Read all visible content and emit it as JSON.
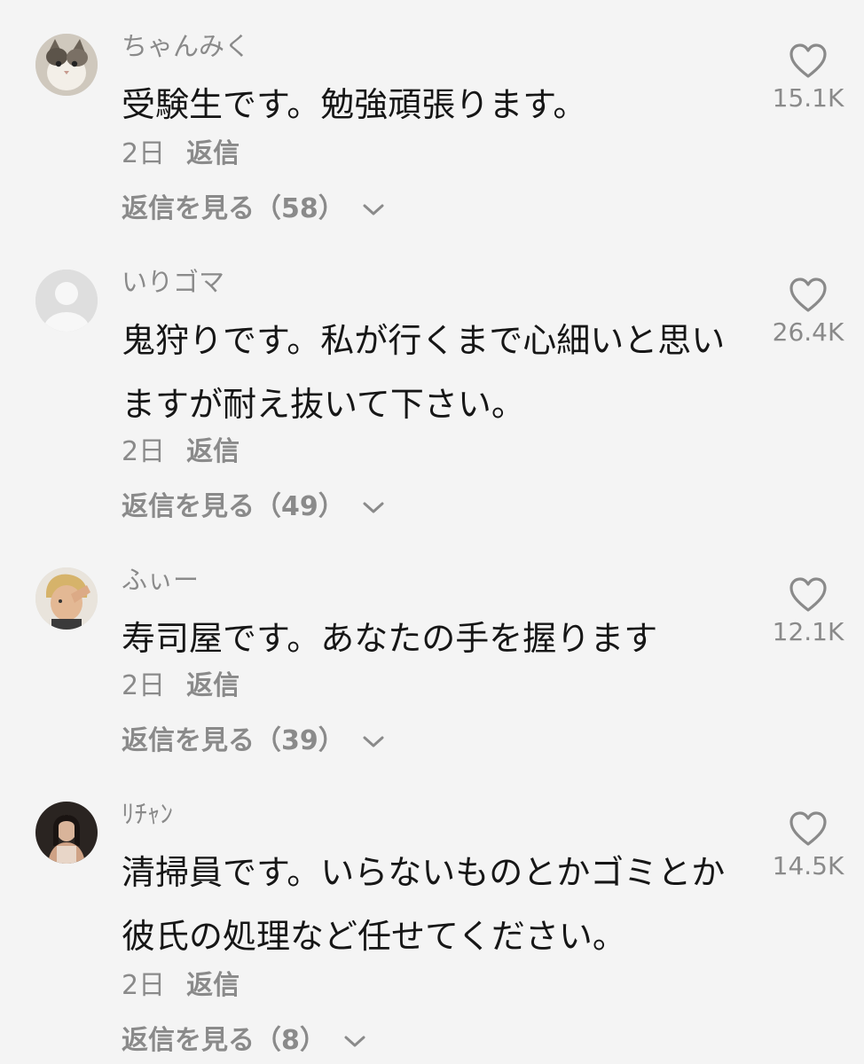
{
  "comments": [
    {
      "username": "ちゃんみく",
      "lines": [
        "受験生です。勉強頑張ります。"
      ],
      "date": "2日",
      "reply_label": "返信",
      "view_replies": "返信を見る（58）",
      "likes": "15.1K",
      "avatar": "cat-photo-avatar"
    },
    {
      "username": "いりゴマ",
      "lines": [
        "鬼狩りです。私が行くまで心細いと思い",
        "ますが耐え抜いて下さい。"
      ],
      "date": "2日",
      "reply_label": "返信",
      "view_replies": "返信を見る（49）",
      "likes": "26.4K",
      "avatar": "default-avatar"
    },
    {
      "username": "ふぃー",
      "lines": [
        "寿司屋です。あなたの手を握ります"
      ],
      "date": "2日",
      "reply_label": "返信",
      "view_replies": "返信を見る（39）",
      "likes": "12.1K",
      "avatar": "person-photo-avatar"
    },
    {
      "username": "ﾘﾁｬﾝ",
      "lines": [
        "清掃員です。いらないものとかゴミとか",
        "彼氏の処理など任せてください。"
      ],
      "date": "2日",
      "reply_label": "返信",
      "view_replies": "返信を見る（8）",
      "likes": "14.5K",
      "avatar": "person-photo-avatar"
    }
  ],
  "icons": {
    "like": "heart-outline-icon",
    "expand": "chevron-down-icon"
  },
  "colors": {
    "background": "#f4f4f4",
    "text_primary": "#161616",
    "text_secondary": "#8a8a8a"
  }
}
